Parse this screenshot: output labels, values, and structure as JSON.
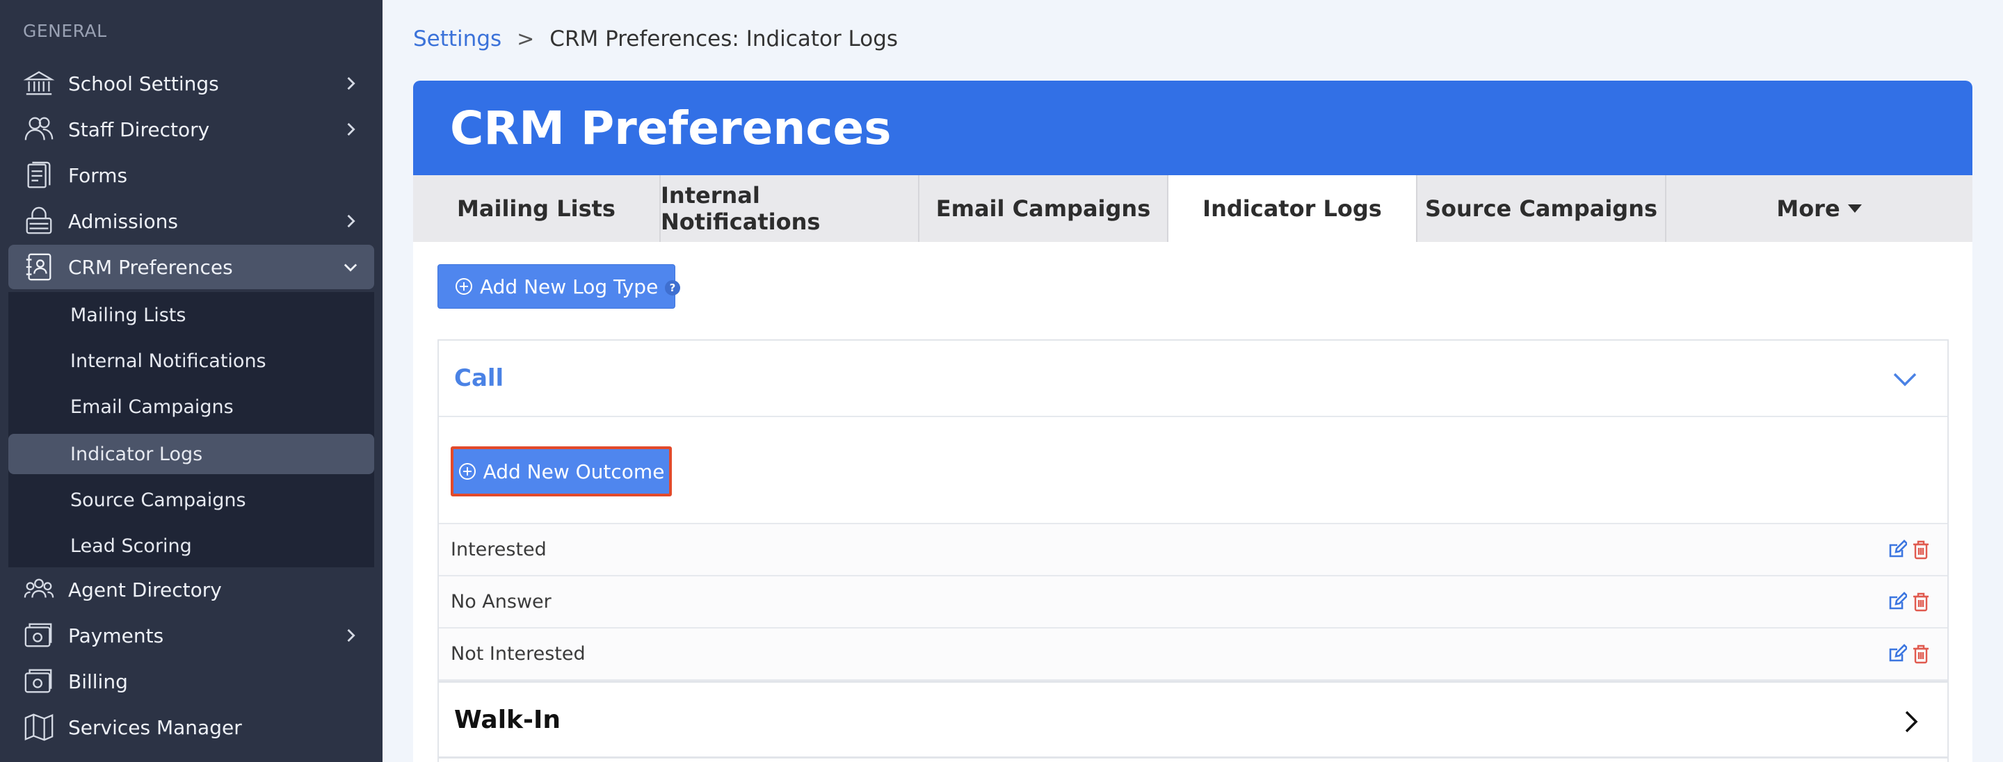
{
  "sidebar": {
    "section_label": "GENERAL",
    "items": [
      {
        "label": "School Settings",
        "icon": "bank-icon",
        "has_chevron": true
      },
      {
        "label": "Staff Directory",
        "icon": "users-icon",
        "has_chevron": true
      },
      {
        "label": "Forms",
        "icon": "forms-icon",
        "has_chevron": false
      },
      {
        "label": "Admissions",
        "icon": "lock-bag-icon",
        "has_chevron": true
      },
      {
        "label": "CRM Preferences",
        "icon": "contact-book-icon",
        "has_chevron": true,
        "expanded": true
      },
      {
        "label": "Agent Directory",
        "icon": "group-icon",
        "has_chevron": false
      },
      {
        "label": "Payments",
        "icon": "wallet-icon",
        "has_chevron": true
      },
      {
        "label": "Billing",
        "icon": "billing-icon",
        "has_chevron": false
      },
      {
        "label": "Services Manager",
        "icon": "map-icon",
        "has_chevron": false
      }
    ],
    "subitems": [
      {
        "label": "Mailing Lists"
      },
      {
        "label": "Internal Notifications"
      },
      {
        "label": "Email Campaigns"
      },
      {
        "label": "Indicator Logs",
        "active": true
      },
      {
        "label": "Source Campaigns"
      },
      {
        "label": "Lead Scoring"
      }
    ]
  },
  "breadcrumb": {
    "link": "Settings",
    "separator": ">",
    "current": "CRM Preferences: Indicator Logs"
  },
  "page": {
    "title": "CRM Preferences",
    "tabs": [
      {
        "label": "Mailing Lists"
      },
      {
        "label": "Internal Notifications"
      },
      {
        "label": "Email Campaigns"
      },
      {
        "label": "Indicator Logs",
        "active": true
      },
      {
        "label": "Source Campaigns"
      },
      {
        "label": "More"
      }
    ],
    "add_log_type_label": "Add New Log Type"
  },
  "log_types": {
    "call": {
      "title": "Call",
      "add_outcome_label": "Add New Outcome",
      "outcomes": [
        {
          "label": "Interested"
        },
        {
          "label": "No Answer"
        },
        {
          "label": "Not Interested"
        }
      ]
    },
    "walkin": {
      "title": "Walk-In"
    }
  },
  "colors": {
    "sidebar_bg": "#2c3345",
    "accent": "#3270e6",
    "button": "#4f86ee",
    "highlight_border": "#e24a2b",
    "delete": "#e05a4f"
  }
}
